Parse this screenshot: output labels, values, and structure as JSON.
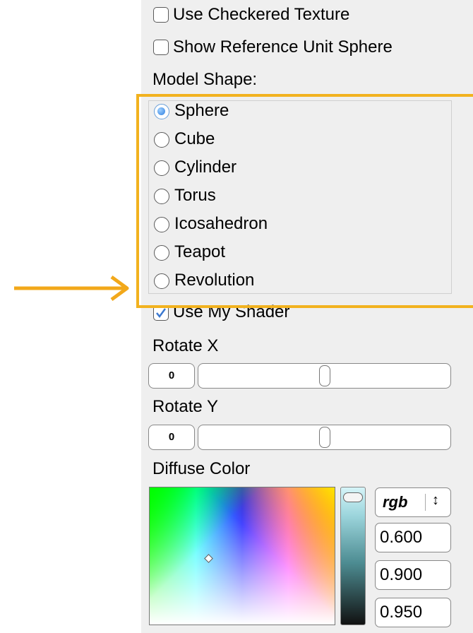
{
  "options": {
    "checkered_texture": {
      "label": "Use Checkered Texture",
      "checked": false
    },
    "reference_sphere": {
      "label": "Show Reference Unit Sphere",
      "checked": false
    }
  },
  "model_shape": {
    "label": "Model Shape:",
    "options": [
      "Sphere",
      "Cube",
      "Cylinder",
      "Torus",
      "Icosahedron",
      "Teapot",
      "Revolution"
    ],
    "selected": "Sphere"
  },
  "shader": {
    "label": "Use My Shader",
    "checked": true
  },
  "rotate_x": {
    "label": "Rotate X",
    "value": "0"
  },
  "rotate_y": {
    "label": "Rotate Y",
    "value": "0"
  },
  "diffuse_color": {
    "label": "Diffuse Color",
    "mode": "rgb",
    "mode_arrow": "↕",
    "r": "0.600",
    "g": "0.900",
    "b": "0.950"
  },
  "colors": {
    "highlight": "#f2b21f",
    "arrow": "#f2a81a"
  }
}
